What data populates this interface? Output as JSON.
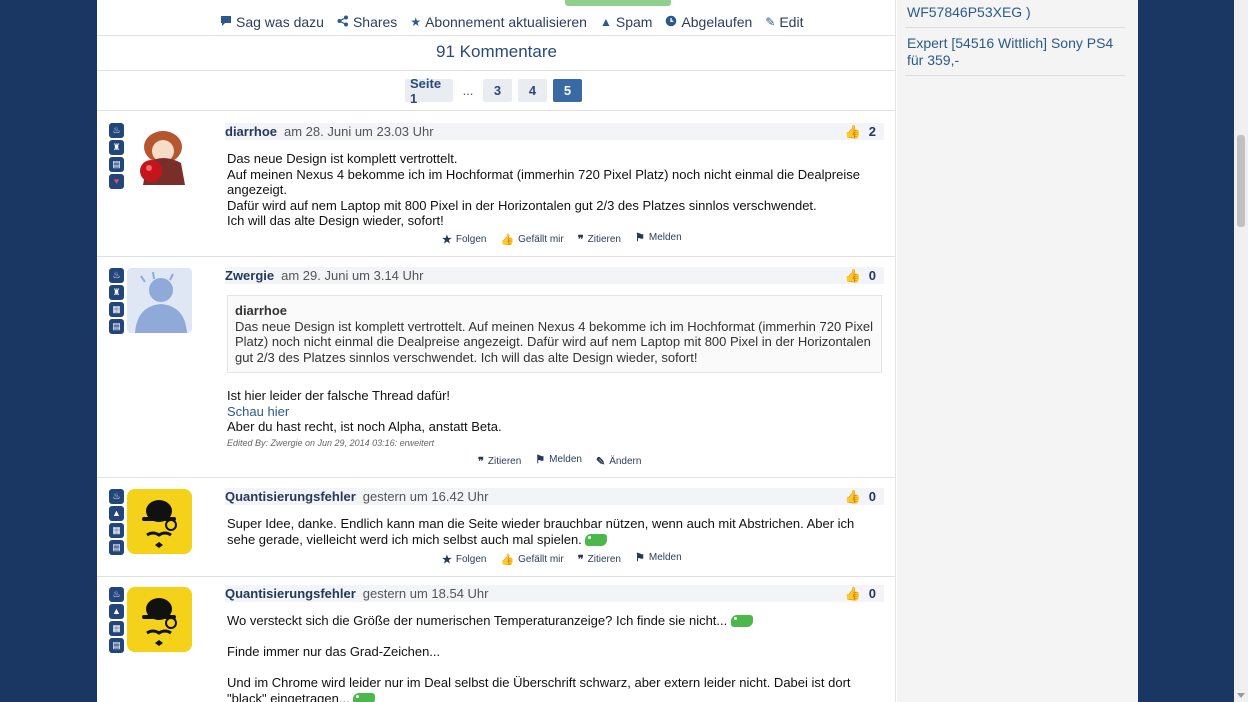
{
  "actions": [
    {
      "icon": "speech-icon",
      "label": "Sag was dazu"
    },
    {
      "icon": "share-icon",
      "label": "Shares"
    },
    {
      "icon": "star-icon",
      "label": "Abonnement aktualisieren"
    },
    {
      "icon": "warning-icon",
      "label": "Spam"
    },
    {
      "icon": "clock-icon",
      "label": "Abgelaufen"
    },
    {
      "icon": "pencil-icon",
      "label": "Edit"
    }
  ],
  "comments_count": "91 Kommentare",
  "pagination": {
    "first": "Seite 1",
    "dots": "...",
    "pages": [
      "3",
      "4",
      "5"
    ],
    "active": "5"
  },
  "comments": [
    {
      "user": "diarrhoe",
      "date": "am 28. Juni um 23.03 Uhr",
      "likes": "2",
      "avatar": "anime-girl-avatar",
      "lines": [
        "Das neue Design ist komplett vertrottelt.",
        "Auf meinen Nexus 4 bekomme ich im Hochformat (immerhin 720 Pixel Platz) noch nicht einmal die Dealpreise angezeigt.",
        "Dafür wird auf nem Laptop mit 800 Pixel in der Horizontalen gut 2/3 des Platzes sinnlos verschwendet.",
        "Ich will das alte Design wieder, sofort!"
      ],
      "footer": [
        "Folgen",
        "Gefällt mir",
        "Zitieren",
        "Melden"
      ]
    },
    {
      "user": "Zwergie",
      "date": "am 29. Juni um 3.14 Uhr",
      "likes": "0",
      "avatar": "person-silhouette-avatar",
      "quote_author": "diarrhoe",
      "quote_text": "Das neue Design ist komplett vertrottelt. Auf meinen Nexus 4 bekomme ich im Hochformat (immerhin 720 Pixel Platz) noch nicht einmal die Dealpreise angezeigt. Dafür wird auf nem Laptop mit 800 Pixel in der Horizontalen gut 2/3 des Platzes sinnlos verschwendet. Ich will das alte Design wieder, sofort!",
      "line1": "Ist hier leider der falsche Thread dafür!",
      "link": "Schau hier",
      "line2": "Aber du hast recht, ist noch Alpha, anstatt Beta.",
      "edited": "Edited By: Zwergie on Jun 29, 2014 03:16: erweitert",
      "footer": [
        "Zitieren",
        "Melden",
        "Ändern"
      ]
    },
    {
      "user": "Quantisierungsfehler",
      "date": "gestern um 16.42 Uhr",
      "likes": "0",
      "avatar": "bowler-hat-avatar",
      "text": "Super Idee, danke. Endlich kann man die Seite wieder brauchbar nützen, wenn auch mit Abstrichen. Aber ich sehe gerade, vielleicht werd ich mich selbst auch mal spielen.",
      "footer": [
        "Folgen",
        "Gefällt mir",
        "Zitieren",
        "Melden"
      ]
    },
    {
      "user": "Quantisierungsfehler",
      "date": "gestern um 18.54 Uhr",
      "likes": "0",
      "avatar": "bowler-hat-avatar",
      "p1": "Wo versteckt sich die Größe der numerischen Temperaturanzeige? Ich finde sie nicht...",
      "p2": "Finde immer nur das Grad-Zeichen...",
      "p3": "Und im Chrome wird leider nur im Deal selbst die Überschrift schwarz, aber extern leider nicht. Dabei ist dort \"black\" eingetragen..."
    }
  ],
  "sidebar": {
    "item1": "WF57846P53XEG )",
    "item2": "Expert [54516 Wittlich] Sony PS4 für 359,-"
  },
  "colors": {
    "background": "#1a3763",
    "accent": "#3a6aa5",
    "username": "#24395a",
    "link": "#2b5a8a"
  }
}
